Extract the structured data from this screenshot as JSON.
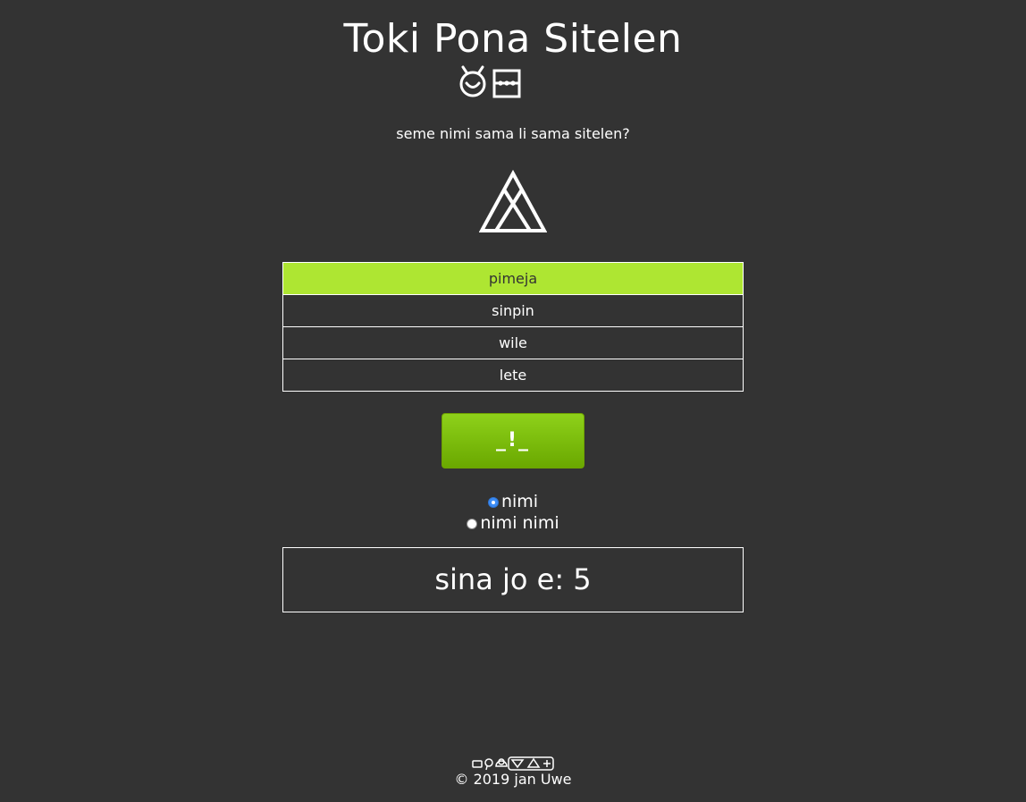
{
  "header": {
    "title": "Toki Pona Sitelen",
    "title_glyphs": [
      "sitelen-icon",
      "pona-icon"
    ]
  },
  "quiz": {
    "question": "seme nimi sama li sama sitelen?",
    "prompt_glyph": "pimeja-glyph-icon",
    "choices": [
      {
        "label": "pimeja",
        "selected": true
      },
      {
        "label": "sinpin",
        "selected": false
      },
      {
        "label": "wile",
        "selected": false
      },
      {
        "label": "lete",
        "selected": false
      }
    ],
    "submit_label": "_!_"
  },
  "mode": {
    "options": [
      {
        "label": "nimi",
        "checked": true
      },
      {
        "label": "nimi nimi",
        "checked": false
      }
    ]
  },
  "score": {
    "text": "sina jo e: 5"
  },
  "footer": {
    "glyphs": "jan-uwe-cartouche-icon",
    "copyright": "© 2019 jan Uwe"
  },
  "colors": {
    "background": "#333333",
    "selected_choice": "#aee632",
    "button_green": "#7cbb0a",
    "radio_checked": "#3b8cf5"
  }
}
